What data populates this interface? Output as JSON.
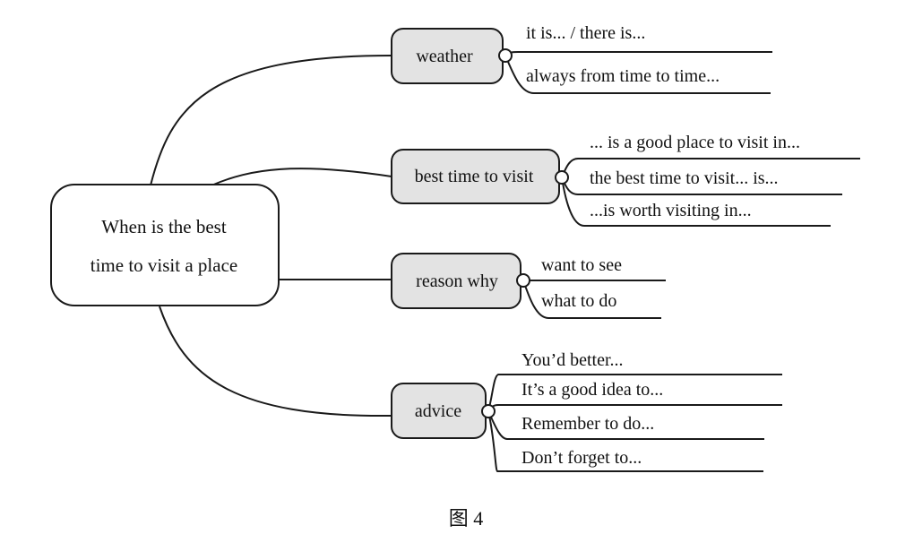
{
  "center": {
    "line1": "When is the best",
    "line2": "time to visit a place"
  },
  "branches": [
    {
      "label": "weather",
      "items": [
        "it is... / there is...",
        "always from time to time..."
      ]
    },
    {
      "label": "best time to visit",
      "items": [
        "... is a good place to visit in...",
        "the best time to visit... is...",
        "...is worth visiting in..."
      ]
    },
    {
      "label": "reason why",
      "items": [
        "want to see",
        "what to do"
      ]
    },
    {
      "label": "advice",
      "items": [
        "You’d better...",
        "It’s a good idea to...",
        "Remember to do...",
        "Don’t forget to..."
      ]
    }
  ],
  "caption": "图 4",
  "colors": {
    "node_fill": "#e3e3e3",
    "stroke": "#1a1a1a",
    "background": "#ffffff"
  }
}
